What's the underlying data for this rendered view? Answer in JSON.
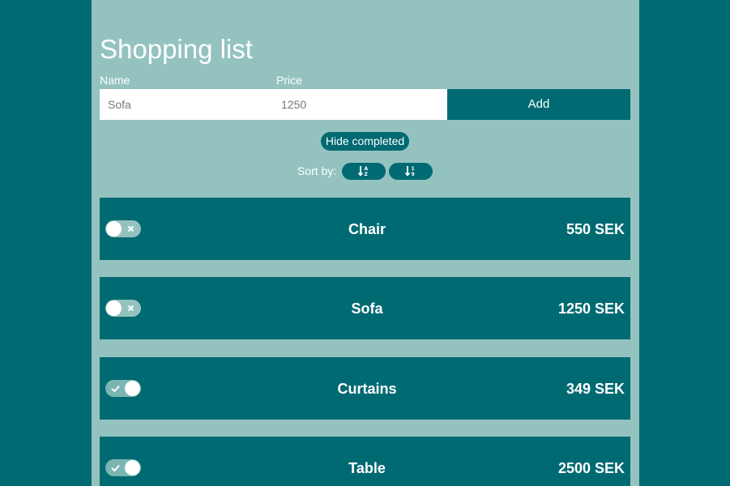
{
  "page": {
    "title": "Shopping list"
  },
  "form": {
    "name_label": "Name",
    "name_value": "Sofa",
    "price_label": "Price",
    "price_value": "1250",
    "add_label": "Add"
  },
  "filters": {
    "hide_completed_label": "Hide completed",
    "sort_label": "Sort by:",
    "sort_alpha_icon": "sort-alpha-icon",
    "sort_numeric_icon": "sort-numeric-icon"
  },
  "items": [
    {
      "name": "Chair",
      "price": "550 SEK",
      "completed": false
    },
    {
      "name": "Sofa",
      "price": "1250 SEK",
      "completed": false
    },
    {
      "name": "Curtains",
      "price": "349 SEK",
      "completed": true
    },
    {
      "name": "Table",
      "price": "2500 SEK",
      "completed": true
    }
  ],
  "colors": {
    "background": "#006a73",
    "panel": "#94c3bf",
    "accent": "#006a73",
    "text": "#ffffff"
  }
}
